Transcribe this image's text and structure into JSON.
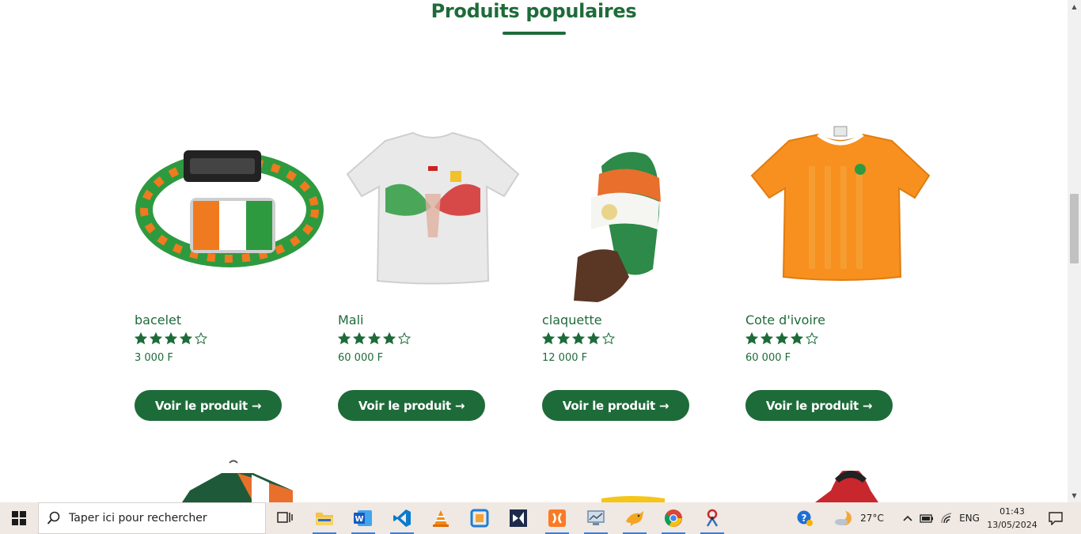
{
  "section": {
    "title": "Produits populaires"
  },
  "products": [
    {
      "name": "bacelet",
      "rating": 4,
      "max_rating": 5,
      "price": "3 000 F",
      "button": "Voir le produit →"
    },
    {
      "name": "Mali",
      "rating": 4,
      "max_rating": 5,
      "price": "60 000 F",
      "button": "Voir le produit →"
    },
    {
      "name": "claquette",
      "rating": 4,
      "max_rating": 5,
      "price": "12 000 F",
      "button": "Voir le produit →"
    },
    {
      "name": "Cote d'ivoire",
      "rating": 4,
      "max_rating": 5,
      "price": "60 000 F",
      "button": "Voir le produit →"
    }
  ],
  "taskbar": {
    "search_placeholder": "Taper ici pour rechercher",
    "apps": [
      "task-view",
      "file-explorer",
      "word",
      "vscode",
      "vlc",
      "virtualbox",
      "visual-studio",
      "xampp",
      "remote-desktop",
      "sql-tool",
      "chrome",
      "paint-tool"
    ],
    "weather": "27°C",
    "language": "ENG",
    "time": "01:43",
    "date": "13/05/2024"
  },
  "colors": {
    "brand_green": "#1e6b3a",
    "taskbar_bg": "#f0e8e2"
  }
}
